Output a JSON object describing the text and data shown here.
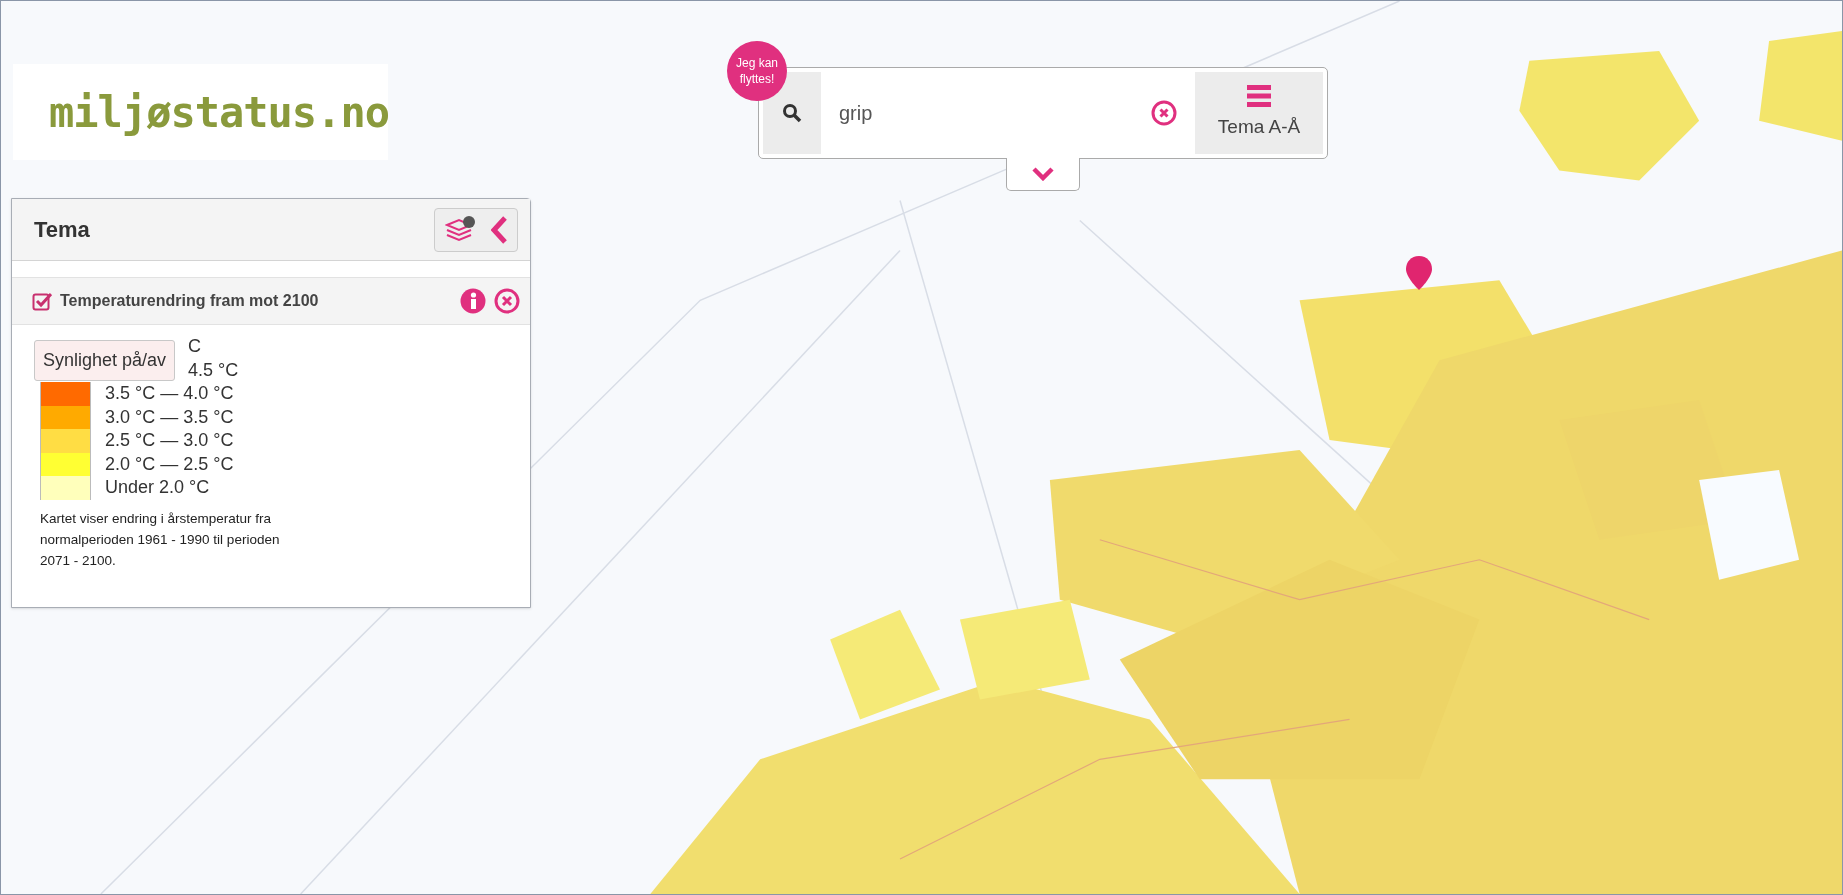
{
  "logo": {
    "text": "miljøstatus.no"
  },
  "search": {
    "badge": "Jeg kan flyttes!",
    "value": "grip",
    "menu_label": "Tema A-Å"
  },
  "panel": {
    "title": "Tema",
    "layer": {
      "title": "Temperaturendring fram mot 2100",
      "checked": true,
      "tooltip": "Synlighet på/av",
      "legend": [
        {
          "label": "C"
        },
        {
          "label": "4.5 °C"
        },
        {
          "label": "3.5 °C — 4.0 °C",
          "color": "#ff6a00"
        },
        {
          "label": "3.0 °C — 3.5 °C",
          "color": "#ffaa00"
        },
        {
          "label": "2.5 °C — 3.0 °C",
          "color": "#ffdd44"
        },
        {
          "label": "2.0 °C — 2.5 °C",
          "color": "#ffff33"
        },
        {
          "label": "Under 2.0 °C",
          "color": "#ffffbb"
        }
      ],
      "description": "Kartet viser endring i årstemperatur fra normalperioden 1961 - 1990 til perioden 2071 - 2100."
    }
  }
}
